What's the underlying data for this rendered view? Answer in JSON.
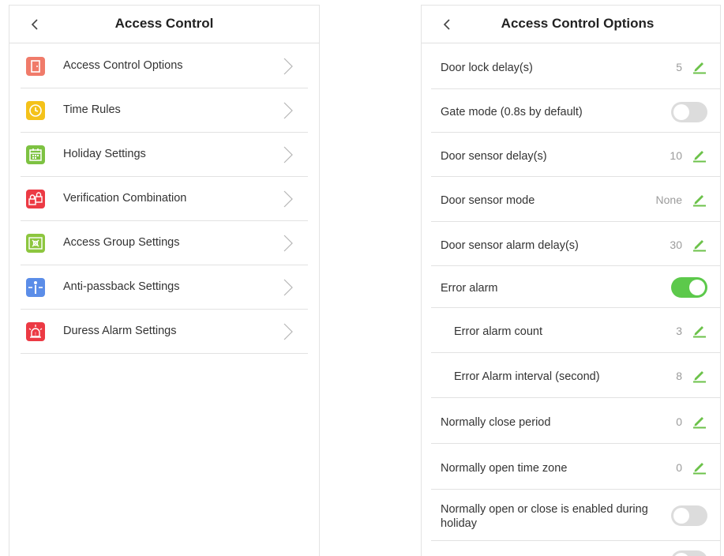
{
  "left": {
    "title": "Access Control",
    "items": [
      {
        "label": "Access Control Options",
        "icon": "door-icon",
        "color": "#f07b6a"
      },
      {
        "label": "Time Rules",
        "icon": "clock-icon",
        "color": "#f4c21a"
      },
      {
        "label": "Holiday Settings",
        "icon": "calendar-icon",
        "color": "#7dc242"
      },
      {
        "label": "Verification Combination",
        "icon": "locks-icon",
        "color": "#ec3a44"
      },
      {
        "label": "Access Group Settings",
        "icon": "group-icon",
        "color": "#8dc63f"
      },
      {
        "label": "Anti-passback Settings",
        "icon": "turnstile-icon",
        "color": "#5b8de8"
      },
      {
        "label": "Duress Alarm Settings",
        "icon": "alarm-icon",
        "color": "#ec3a44"
      }
    ]
  },
  "right": {
    "title": "Access Control Options",
    "options": [
      {
        "label": "Door lock delay(s)",
        "value": "5"
      },
      {
        "label": "Gate mode (0.8s by default)",
        "toggle": "off"
      },
      {
        "label": "Door sensor delay(s)",
        "value": "10"
      },
      {
        "label": "Door sensor mode",
        "value": "None"
      },
      {
        "label": "Door sensor alarm delay(s)",
        "value": "30"
      },
      {
        "label": "Error alarm",
        "toggle": "on"
      },
      {
        "label": "Error alarm count",
        "value": "3"
      },
      {
        "label": "Error Alarm interval (second)",
        "value": "8"
      },
      {
        "label": "Normally close period",
        "value": "0"
      },
      {
        "label": "Normally open time zone",
        "value": "0"
      },
      {
        "label": "Normally open or close is enabled during",
        "label2": "holiday",
        "toggle": "off"
      }
    ]
  },
  "colors": {
    "accent_green": "#5cc94b",
    "toggle_off": "#dcdcdc",
    "edit_icon": "#6cc24a"
  }
}
